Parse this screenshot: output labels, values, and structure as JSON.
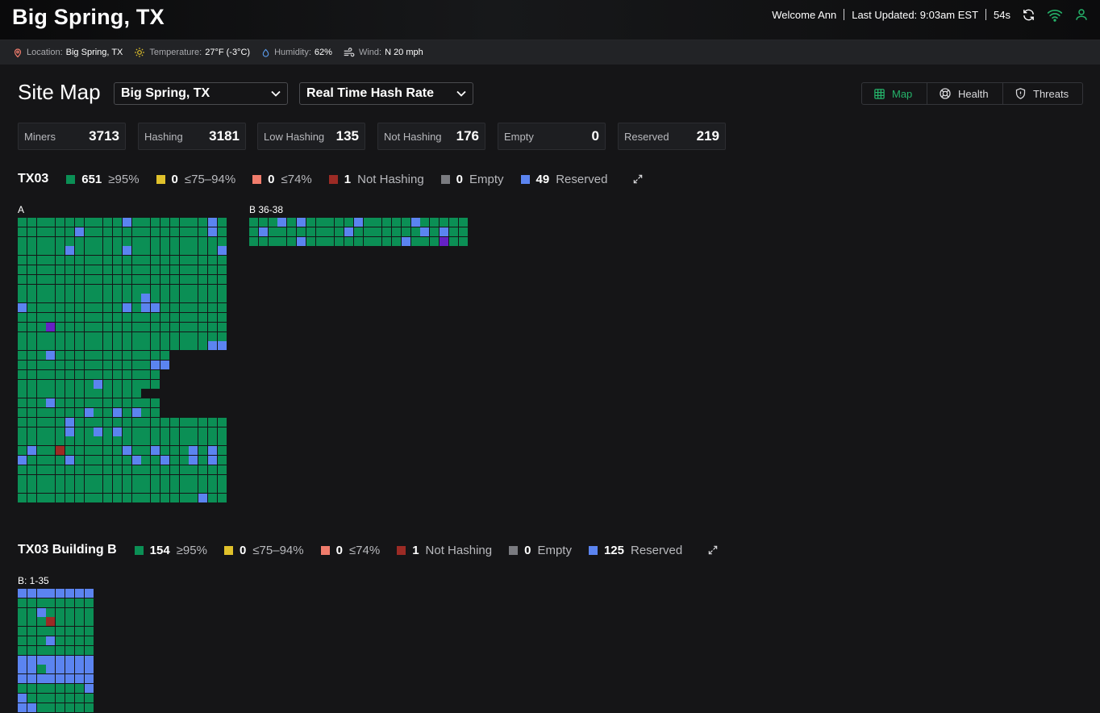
{
  "header": {
    "title": "Big Spring, TX",
    "welcome": "Welcome Ann",
    "last_updated": "Last Updated: 9:03am EST",
    "countdown": "54s"
  },
  "weather": {
    "location_label": "Location:",
    "location": "Big Spring, TX",
    "temperature_label": "Temperature:",
    "temperature": "27°F (-3°C)",
    "humidity_label": "Humidity:",
    "humidity": "62%",
    "wind_label": "Wind:",
    "wind": "N 20 mph"
  },
  "page": {
    "title": "Site Map",
    "site_select": "Big Spring, TX",
    "metric_select": "Real Time Hash Rate"
  },
  "tabs": [
    {
      "label": "Map"
    },
    {
      "label": "Health"
    },
    {
      "label": "Threats"
    }
  ],
  "stats": [
    {
      "label": "Miners",
      "value": "3713"
    },
    {
      "label": "Hashing",
      "value": "3181"
    },
    {
      "label": "Low Hashing",
      "value": "135"
    },
    {
      "label": "Not Hashing",
      "value": "176"
    },
    {
      "label": "Empty",
      "value": "0"
    },
    {
      "label": "Reserved",
      "value": "219"
    }
  ],
  "colors": {
    "green": "#0b8f55",
    "yellow": "#e0c12b",
    "salmon": "#f07c6c",
    "red": "#9c2b25",
    "gray": "#7a7b80",
    "blue": "#5b84f0",
    "purple": "#6521c4",
    "accent": "#25b36a"
  },
  "sections": [
    {
      "title": "TX03",
      "legend": [
        {
          "count": "651",
          "label": "≥95%"
        },
        {
          "count": "0",
          "label": "≤75–94%"
        },
        {
          "count": "0",
          "label": "≤74%"
        },
        {
          "count": "1",
          "label": "Not Hashing"
        },
        {
          "count": "0",
          "label": "Empty"
        },
        {
          "count": "49",
          "label": "Reserved"
        }
      ],
      "grids": [
        {
          "label": "A",
          "rows": [
            "GGGGGGGGGGGBGGGGGGGGBG",
            "GGGGGGBGGGGGGGGGGGGGBG",
            "GGGGGGGGGGGGGGGGGGGGGG",
            "GGGGGBGGGGGBGGGGGGGGGB",
            "GGGGGGGGGGGGGGGGGGGGGG",
            "GGGGGGGGGGGGGGGGGGGGGG",
            "GGGGGGGGGGGGGGGGGGGGGG",
            "GGGGGGGGGGGGGGGGGGGGGG",
            "GGGGGGGGGGGGGBGGGGGGGG",
            "BGGGGGGGGGGBGBBGGGGGGG",
            "GGGGGGGGGGGGGGGGGGGGGG",
            "GGGPGGGGGGGGGGGGGGGGGG",
            "GGGGGGGGGGGGGGGGGGGGGG",
            "GGGGGGGGGGGGGGGGGGGGBB",
            "GGGBGGGGGGGGGGGG......",
            "GGGGGGGGGGGGGGBB......",
            "GGGGGGGGGGGGGGG.......",
            "GGGGGGGGBGGGGGG.......",
            "GGGGGGGGGGGGG.........",
            "GGGBGGGGGGGGGGG.......",
            "GGGGGGGBGGBGBGG.......",
            "GGGGGBGGGGGGGGGGGGGGGG",
            "GGGGGBGGBGBGGGGGGGGGGG",
            "GGGGGGGGGGGGGGGGGGGGGG",
            "GBGGRGGGGGGBGGBGGGBGBG",
            "BGGGGBGGGGGGBGGBGGBGBG",
            "GGGGGGGGGGGGGGGGGGGGGG",
            "GGGGGGGGGGGGGGGGGGGGGG",
            "GGGGGGGGGGGGGGGGGGGGGG",
            "GGGGGGGGGGGGGGGGGGGBGG"
          ]
        },
        {
          "label": "B 36-38",
          "rows": [
            "GGGBGBGGGGGBGGGGGBGGGGG",
            "GBGGGGGGGGBGGGGGGGBGBGG",
            "GGGGGBGGGGGGGGGGBGGGPGG"
          ]
        }
      ]
    },
    {
      "title": "TX03 Building B",
      "legend": [
        {
          "count": "154",
          "label": "≥95%"
        },
        {
          "count": "0",
          "label": "≤75–94%"
        },
        {
          "count": "0",
          "label": "≤74%"
        },
        {
          "count": "1",
          "label": "Not Hashing"
        },
        {
          "count": "0",
          "label": "Empty"
        },
        {
          "count": "125",
          "label": "Reserved"
        }
      ],
      "grids": [
        {
          "label": "B: 1-35",
          "rows": [
            "BBBBBBBB",
            "GGGGGGGG",
            "GGBGGGGG",
            "GGGRGGGG",
            "GGGGGGGG",
            "GGGBGGGG",
            "GGGGGGGG",
            "BBBBBBBB",
            "BBGBBBBB",
            "BBBBBBBB",
            "GGGGGGGB",
            "BGGGGGGG",
            "BBGGGGGG"
          ]
        }
      ]
    }
  ]
}
